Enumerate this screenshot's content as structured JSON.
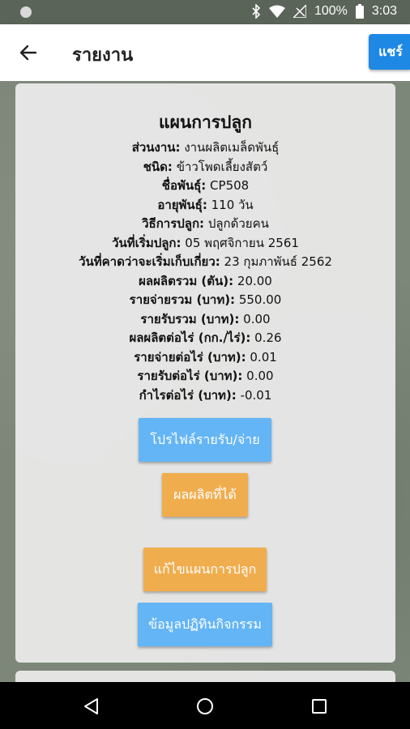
{
  "status_bar": {
    "battery": "100%",
    "time": "3:03",
    "icons": [
      "bluetooth-icon",
      "wifi-icon",
      "no-signal-icon",
      "battery-icon"
    ]
  },
  "appbar": {
    "back_icon": "arrow-left-icon",
    "title": "รายงาน",
    "share_label": "แชร์"
  },
  "plan": {
    "title": "แผนการปลูก",
    "rows": [
      {
        "label": "ส่วนงาน:",
        "value": " งานผลิตเมล็ดพันธุ์"
      },
      {
        "label": "ชนิด:",
        "value": " ข้าวโพดเลี้ยงสัตว์"
      },
      {
        "label": "ชื่อพันธุ์:",
        "value": " CP508"
      },
      {
        "label": "อายุพันธุ์:",
        "value": " 110 วัน"
      },
      {
        "label": "วิธีการปลูก:",
        "value": " ปลูกด้วยคน"
      },
      {
        "label": "วันที่เริ่มปลูก:",
        "value": " 05 พฤศจิกายน 2561"
      },
      {
        "label": "วันที่คาดว่าจะเริ่มเก็บเกี่ยว:",
        "value": " 23 กุมภาพันธ์ 2562"
      },
      {
        "label": "ผลผลิตรวม (ตัน):",
        "value": " 20.00"
      },
      {
        "label": "รายจ่ายรวม (บาท):",
        "value": " 550.00"
      },
      {
        "label": "รายรับรวม (บาท):",
        "value": " 0.00"
      },
      {
        "label": "ผลผลิตต่อไร่ (กก./ไร่):",
        "value": " 0.26"
      },
      {
        "label": "รายจ่ายต่อไร่ (บาท):",
        "value": " 0.01"
      },
      {
        "label": "รายรับต่อไร่ (บาท):",
        "value": " 0.00"
      },
      {
        "label": "กำไรต่อไร่ (บาท):",
        "value": " -0.01"
      }
    ]
  },
  "buttons": {
    "profile": "โปรไฟล์รายรับ/จ่าย",
    "yield": "ผลผลิตที่ได้",
    "edit_plan": "แก้ไขแผนการปลูก",
    "activity_calendar": "ข้อมูลปฏิทินกิจกรรม"
  },
  "colors": {
    "share": "#1e88e5",
    "blue_button": "#64b5f6",
    "orange_button": "#f0ad4e"
  },
  "nav": {
    "icons": [
      "back-triangle-icon",
      "home-circle-icon",
      "recents-square-icon"
    ]
  }
}
